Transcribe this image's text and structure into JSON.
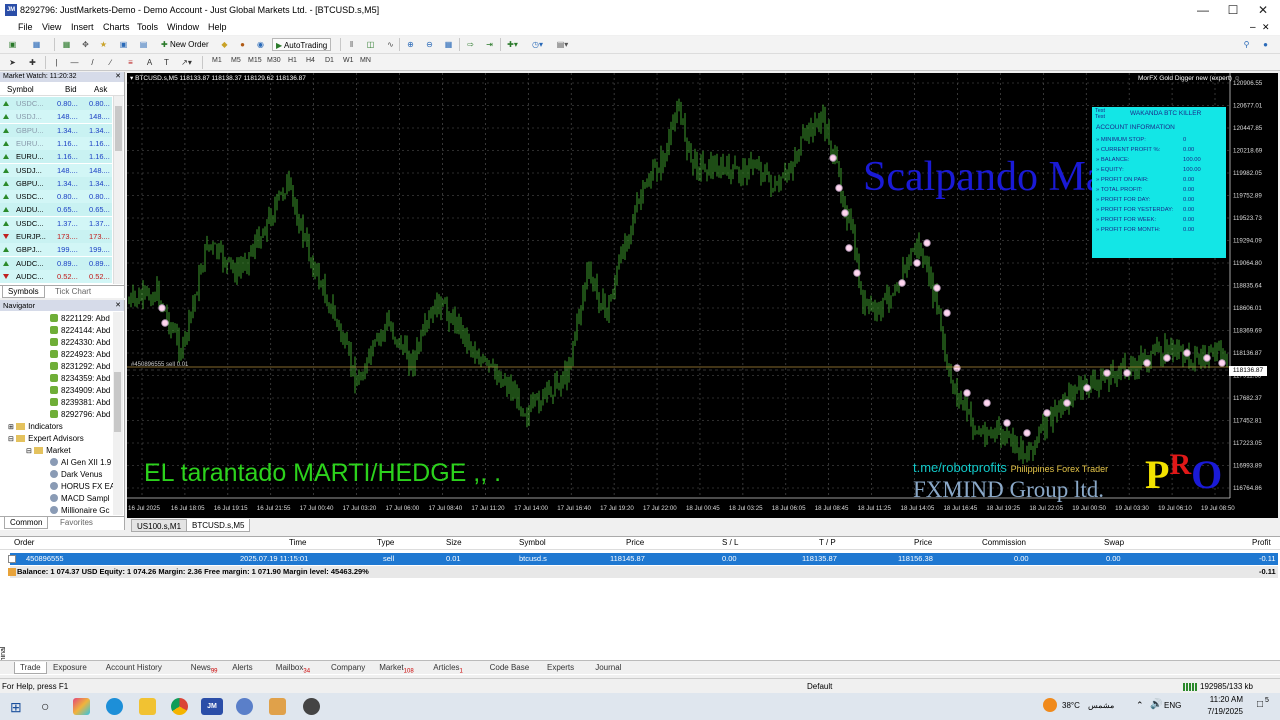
{
  "window": {
    "title": "8292796: JustMarkets-Demo - Demo Account - Just Global Markets Ltd. - [BTCUSD.s,M5]",
    "app_icon": "JM"
  },
  "menu": [
    "File",
    "View",
    "Insert",
    "Charts",
    "Tools",
    "Window",
    "Help"
  ],
  "toolbar": {
    "new_order": "New Order",
    "autotrading": "AutoTrading"
  },
  "timeframes": [
    "M1",
    "M5",
    "M15",
    "M30",
    "H1",
    "H4",
    "D1",
    "W1",
    "MN"
  ],
  "market_watch": {
    "header": "Market Watch: 11:20:32",
    "columns": [
      "Symbol",
      "Bid",
      "Ask"
    ],
    "rows": [
      {
        "symbol": "USDC...",
        "bid": "0.80...",
        "ask": "0.80...",
        "dir": "up"
      },
      {
        "symbol": "USDJ...",
        "bid": "148....",
        "ask": "148....",
        "dir": "up"
      },
      {
        "symbol": "GBPU...",
        "bid": "1.34...",
        "ask": "1.34...",
        "dir": "up"
      },
      {
        "symbol": "EURU...",
        "bid": "1.16...",
        "ask": "1.16...",
        "dir": "up"
      },
      {
        "symbol": "EURU...",
        "bid": "1.16...",
        "ask": "1.16...",
        "dir": "up"
      },
      {
        "symbol": "USDJ...",
        "bid": "148....",
        "ask": "148....",
        "dir": "up"
      },
      {
        "symbol": "GBPU...",
        "bid": "1.34...",
        "ask": "1.34...",
        "dir": "up"
      },
      {
        "symbol": "USDC...",
        "bid": "0.80...",
        "ask": "0.80...",
        "dir": "up"
      },
      {
        "symbol": "AUDU...",
        "bid": "0.65...",
        "ask": "0.65...",
        "dir": "up"
      },
      {
        "symbol": "USDC...",
        "bid": "1.37...",
        "ask": "1.37...",
        "dir": "up"
      },
      {
        "symbol": "EURJP...",
        "bid": "173....",
        "ask": "173....",
        "dir": "down"
      },
      {
        "symbol": "GBPJ...",
        "bid": "199....",
        "ask": "199....",
        "dir": "up"
      },
      {
        "symbol": "AUDC...",
        "bid": "0.89...",
        "ask": "0.89...",
        "dir": "up"
      },
      {
        "symbol": "AUDC...",
        "bid": "0.52...",
        "ask": "0.52...",
        "dir": "down"
      }
    ],
    "tabs": [
      "Symbols",
      "Tick Chart"
    ]
  },
  "navigator": {
    "header": "Navigator",
    "accounts": [
      "8221129: Abd",
      "8224144: Abd",
      "8224330: Abd",
      "8224923: Abd",
      "8231292: Abd",
      "8234359: Abd",
      "8234909: Abd",
      "8239381: Abd",
      "8292796: Abd"
    ],
    "indicators": "Indicators",
    "expert_advisors": "Expert Advisors",
    "market": "Market",
    "eas": [
      "AI Gen XII 1.9",
      "Dark Venus",
      "HORUS FX EA",
      "MACD Sampl",
      "Millionaire Gc"
    ],
    "tabs": [
      "Common",
      "Favorites"
    ]
  },
  "chart": {
    "info": "BTCUSD.s,M5  118133.87 118138.37 118129.62 118136.87",
    "expert": "MorFX Gold Digger new (expert)",
    "order_line_label": "#450896555 sell 0.01",
    "current_price": "118136.87",
    "overlay_scalpando": "Scalpando Marti",
    "overlay_tarantado": "EL tarantado MARTI/HEDGE ,, .",
    "overlay_telegram": "t.me/robotprofits",
    "overlay_ph": "Philippines Forex Trader",
    "overlay_fxmind": "FXMIND Group ltd.",
    "logo_letters": [
      "P",
      "R",
      "O"
    ],
    "y_ticks": [
      "120906.55",
      "120677.01",
      "120447.85",
      "120218.69",
      "119982.05",
      "119752.89",
      "119523.73",
      "119294.09",
      "119064.80",
      "118835.64",
      "118606.01",
      "118369.69",
      "118136.87",
      "117911.53",
      "117682.37",
      "117452.81",
      "117223.05",
      "116993.89",
      "116764.86"
    ],
    "x_ticks": [
      "16 Jul 2025",
      "16 Jul 18:05",
      "16 Jul 19:15",
      "16 Jul 21:55",
      "17 Jul 00:40",
      "17 Jul 03:20",
      "17 Jul 06:00",
      "17 Jul 08:40",
      "17 Jul 11:20",
      "17 Jul 14:00",
      "17 Jul 16:40",
      "17 Jul 19:20",
      "17 Jul 22:00",
      "18 Jul 00:45",
      "18 Jul 03:25",
      "18 Jul 06:05",
      "18 Jul 08:45",
      "18 Jul 11:25",
      "18 Jul 14:05",
      "18 Jul 16:45",
      "18 Jul 19:25",
      "18 Jul 22:05",
      "19 Jul 00:50",
      "19 Jul 03:30",
      "19 Jul 06:10",
      "19 Jul 08:50"
    ],
    "panel": {
      "ea_name": "WAKANDA BTC KILLER",
      "test_label": "Test",
      "account_info": "ACCOUNT INFORMATION",
      "rows": [
        {
          "label": "» MINIMUM STOP:",
          "value": "0"
        },
        {
          "label": "» CURRENT PROFIT %:",
          "value": "0.00"
        },
        {
          "label": "» BALANCE:",
          "value": "100.00"
        },
        {
          "label": "» EQUITY:",
          "value": "100.00"
        },
        {
          "label": "» PROFIT ON PAIR:",
          "value": "0.00"
        },
        {
          "label": "» TOTAL PROFIT:",
          "value": "0.00"
        },
        {
          "label": "» PROFIT FOR DAY:",
          "value": "0.00"
        },
        {
          "label": "» PROFIT FOR YESTERDAY:",
          "value": "0.00"
        },
        {
          "label": "» PROFIT FOR WEEK:",
          "value": "0.00"
        },
        {
          "label": "» PROFIT FOR MONTH:",
          "value": "0.00"
        }
      ]
    },
    "colors": {
      "bg": "#000000",
      "candles": "#3d9a2b",
      "overlay_blue": "#1a1ad6",
      "overlay_green": "#2cd21c",
      "panel": "#13e6e6"
    }
  },
  "chart_tabs": [
    "US100.s,M1",
    "BTCUSD.s,M5"
  ],
  "terminal": {
    "columns": [
      "Order",
      "Time",
      "Type",
      "Size",
      "Symbol",
      "Price",
      "S / L",
      "T / P",
      "Price",
      "Commission",
      "Swap",
      "Profit"
    ],
    "order": {
      "order": "450896555",
      "time": "2025.07.19 11:15:01",
      "type": "sell",
      "size": "0.01",
      "symbol": "btcusd.s",
      "price": "118145.87",
      "sl": "0.00",
      "tp": "118135.87",
      "cur_price": "118156.38",
      "commission": "0.00",
      "swap": "0.00",
      "profit": "-0.11"
    },
    "balance_line": "Balance: 1 074.37 USD  Equity: 1 074.26  Margin: 2.36  Free margin: 1 071.90  Margin level: 45463.29%",
    "balance_profit": "-0.11",
    "side_label": "Terminal",
    "tabs": [
      {
        "label": "Trade",
        "count": ""
      },
      {
        "label": "Exposure",
        "count": ""
      },
      {
        "label": "Account History",
        "count": ""
      },
      {
        "label": "News",
        "count": "99"
      },
      {
        "label": "Alerts",
        "count": ""
      },
      {
        "label": "Mailbox",
        "count": "34"
      },
      {
        "label": "Company",
        "count": ""
      },
      {
        "label": "Market",
        "count": "108"
      },
      {
        "label": "Articles",
        "count": "1"
      },
      {
        "label": "Code Base",
        "count": ""
      },
      {
        "label": "Experts",
        "count": ""
      },
      {
        "label": "Journal",
        "count": ""
      }
    ]
  },
  "status": {
    "help": "For Help, press F1",
    "profile": "Default",
    "traffic": "192985/133 kb"
  },
  "taskbar": {
    "weather": "38°C",
    "weather_desc": "مشمس",
    "lang": "ENG",
    "time": "11:20 AM",
    "date": "7/19/2025",
    "notif": "5"
  }
}
